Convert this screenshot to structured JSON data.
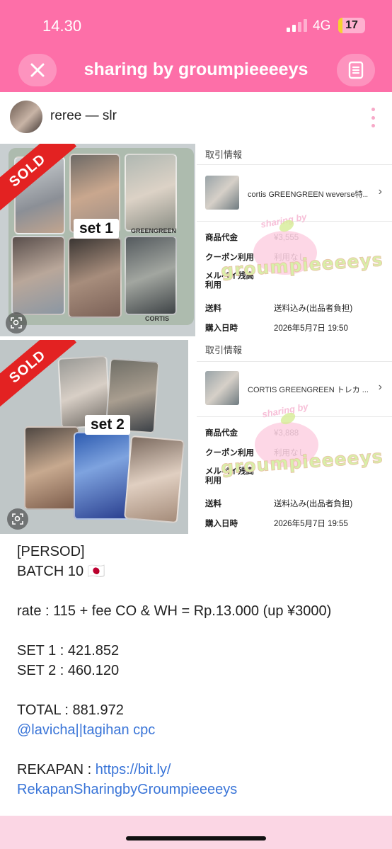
{
  "status_bar": {
    "time": "14.30",
    "network": "4G",
    "battery": "17",
    "battery_level": 0.17
  },
  "header": {
    "title": "sharing by groumpieeeeys",
    "close_icon": "close-icon",
    "menu_icon": "document-icon"
  },
  "post": {
    "username": "reree — slr"
  },
  "images": [
    {
      "sold_label": "SOLD",
      "set_label": "set 1",
      "brand_top": "GREENGREEN",
      "brand_bottom": "CORTIS"
    },
    {
      "sold_label": "SOLD",
      "set_label": "set 2"
    }
  ],
  "orders": [
    {
      "section_title": "取引情報",
      "item_name": "cortis GREENGREEN weverse特...",
      "rows": [
        {
          "key": "商品代金",
          "value": "¥3,555"
        },
        {
          "key": "クーポン利用",
          "value": "利用なし"
        },
        {
          "key": "メルペイ残高利用",
          "value": ""
        },
        {
          "key": "送料",
          "value": "送料込み(出品者負担)"
        },
        {
          "key": "購入日時",
          "value": "2026年5月7日 19:50"
        }
      ]
    },
    {
      "section_title": "取引情報",
      "item_name": "CORTIS GREENGREEN トレカ ...",
      "rows": [
        {
          "key": "商品代金",
          "value": "¥3,888"
        },
        {
          "key": "クーポン利用",
          "value": "利用なし"
        },
        {
          "key": "メルペイ残高利用",
          "value": ""
        },
        {
          "key": "送料",
          "value": "送料込み(出品者負担)"
        },
        {
          "key": "購入日時",
          "value": "2026年5月7日 19:55"
        }
      ]
    }
  ],
  "watermark": {
    "top_text": "sharing by",
    "main_text": "groumpieeeeys"
  },
  "caption": {
    "line1": "[PERSOD]",
    "line2": "BATCH 10 🇯🇵",
    "rate": "rate : 115 + fee CO & WH = Rp.13.000 (up ¥3000)",
    "set1": "SET 1 : 421.852",
    "set2": "SET 2 : 460.120",
    "total": "TOTAL : 881.972",
    "mentions": "@lavicha||tagihan cpc",
    "rekapan_label": "REKAPAN : ",
    "rekapan_link_part1": "https://bit.ly/",
    "rekapan_link_part2": "RekapanSharingbyGroumpieeeeys"
  },
  "colors": {
    "header_pink": "#fd6fa8",
    "sold_red": "#e32222",
    "link_blue": "#3a75d8"
  }
}
